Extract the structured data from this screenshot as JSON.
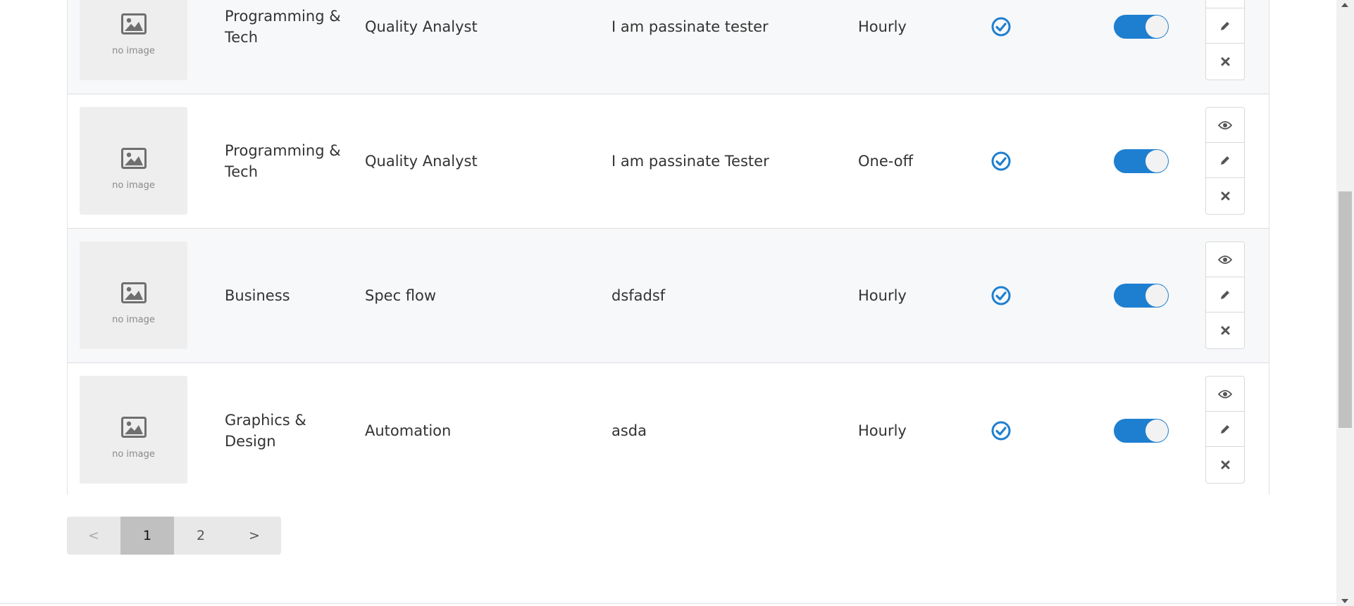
{
  "rows": [
    {
      "image_text": "no image",
      "category": "Programming & Tech",
      "title": "Quality Analyst",
      "description": "I am passinate tester",
      "type": "Hourly",
      "verified": true,
      "active": true
    },
    {
      "image_text": "no image",
      "category": "Programming & Tech",
      "title": "Quality Analyst",
      "description": "I am passinate Tester",
      "type": "One-off",
      "verified": true,
      "active": true
    },
    {
      "image_text": "no image",
      "category": "Business",
      "title": "Spec flow",
      "description": "dsfadsf",
      "type": "Hourly",
      "verified": true,
      "active": true
    },
    {
      "image_text": "no image",
      "category": "Graphics & Design",
      "title": "Automation",
      "description": "asda",
      "type": "Hourly",
      "verified": true,
      "active": true
    }
  ],
  "pagination": {
    "prev": "<",
    "pages": [
      "1",
      "2"
    ],
    "next": ">",
    "current": "1"
  },
  "colors": {
    "accent": "#1e7fd0",
    "row_alt": "#f7f8fa"
  },
  "icons": {
    "view": "eye-icon",
    "edit": "pencil-icon",
    "delete": "close-icon",
    "verified": "check-circle-icon",
    "placeholder": "image-icon"
  }
}
